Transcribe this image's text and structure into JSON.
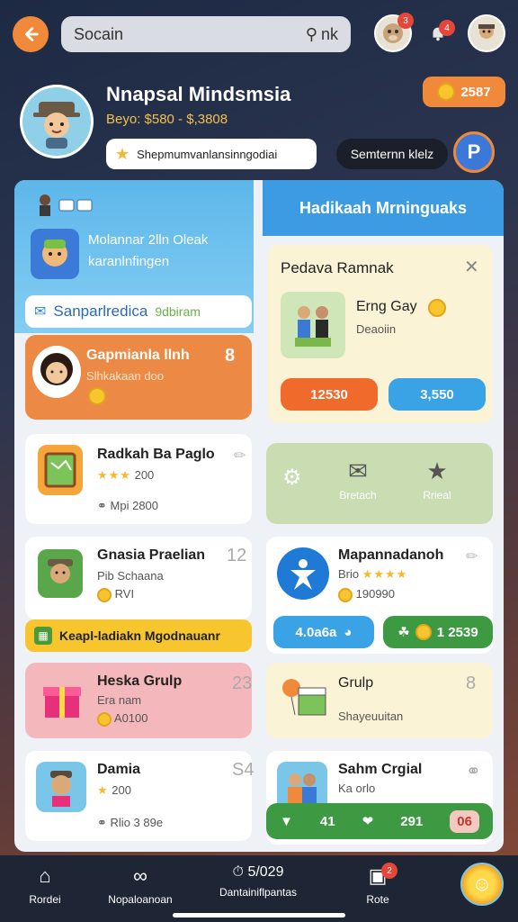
{
  "header": {
    "search_placeholder": "Socain",
    "search_suffix": "nk",
    "notif_1": "3",
    "notif_2": "4"
  },
  "profile": {
    "name": "Nnapsal Mindsmsia",
    "subtitle": "Beyo: $580 - $,3808",
    "coins": "2587",
    "status": "Shepmumvanlansinngodiai",
    "action": "Semternn klelz",
    "help": "P"
  },
  "left_section": {
    "feature": {
      "title": "Molannar 2lln Oleak",
      "sub": "karanlnfingen"
    },
    "search_bar": {
      "text": "Sanparlredica",
      "suffix": "9dbiram"
    },
    "highlight": {
      "title": "Gapmianla llnh",
      "sub": "Slhkakaan doo",
      "badge": "8"
    }
  },
  "right_section": {
    "header": "Hadikaah Mrninguaks",
    "popup": {
      "title": "Pedava Ramnak",
      "item_title": "Erng Gay",
      "item_sub": "Deaoiin",
      "btn_left": "12530",
      "btn_right": "3,550"
    },
    "actions": {
      "left": "Bretach",
      "right": "Rrieal"
    }
  },
  "cards": [
    {
      "title": "Radkah Ba Paglo",
      "sub": "200",
      "meta": "Mpi 2800"
    },
    {
      "title": "Gnasia Praelian",
      "sub1": "Pib Schaana",
      "sub2": "RVI",
      "badge": "12"
    },
    {
      "title": "Mapannadanoh",
      "sub1": "Brio",
      "sub2": "190990",
      "btn_left": "4.0a6a",
      "btn_right": "1 2539"
    },
    {
      "title": "Heska Grulp",
      "sub1": "Era nam",
      "sub2": "A0100",
      "badge": "23"
    },
    {
      "title": "Grulp",
      "sub": "Shayeuuitan",
      "badge": "8"
    },
    {
      "title": "Damia",
      "sub": "200",
      "meta": "Rlio 3 89e",
      "badge": "S4"
    },
    {
      "title": "Sahm Crgial",
      "sub": "Ka orlo",
      "stat1": "41",
      "stat2": "291",
      "stat3": "06"
    }
  ],
  "banner": "Keapl-ladiakn Mgodnauanr",
  "nav": [
    {
      "label": "Rordei",
      "icon": "home-icon"
    },
    {
      "label": "Nopaloanoan",
      "icon": "network-icon"
    },
    {
      "label": "Dantainiflpantas",
      "value": "5/029",
      "icon": "timer-icon"
    },
    {
      "label": "Rote",
      "icon": "game-icon",
      "notif": "2"
    }
  ],
  "colors": {
    "accent": "#f08a3a",
    "blue": "#3d9be3",
    "green": "#3d9a43"
  }
}
